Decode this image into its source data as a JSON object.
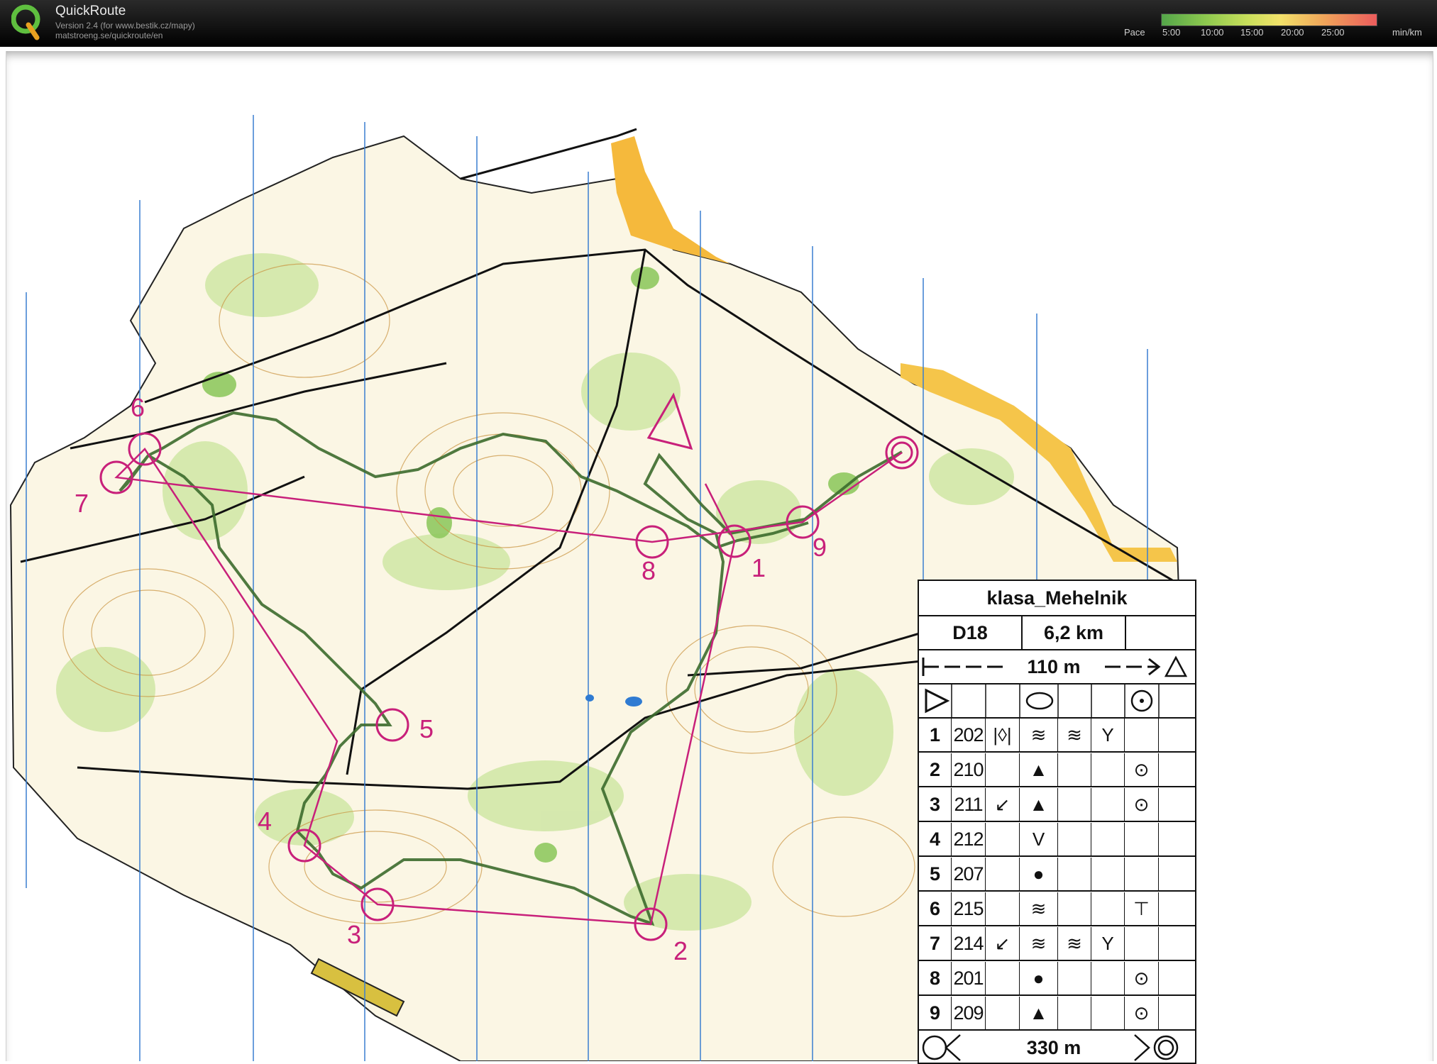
{
  "app": {
    "title": "QuickRoute",
    "version": "Version 2.4  (for www.bestik.cz/mapy)",
    "url": "matstroeng.se/quickroute/en"
  },
  "pace_legend": {
    "label": "Pace",
    "ticks": [
      "5:00",
      "10:00",
      "15:00",
      "20:00",
      "25:00"
    ],
    "unit": "min/km",
    "colors": [
      "#54a54a",
      "#8cc84e",
      "#c9df5b",
      "#f2e26a",
      "#f0a65a",
      "#ec5c5c"
    ]
  },
  "map": {
    "course_color": "#c8207a",
    "route_color": "#3a5a2a",
    "control_labels": [
      "1",
      "2",
      "3",
      "4",
      "5",
      "6",
      "7",
      "8",
      "9"
    ]
  },
  "description": {
    "event": "klasa_Mehelnik",
    "class": "D18",
    "length": "6,2 km",
    "start_distance": "110 m",
    "finish_distance": "330 m",
    "controls": [
      {
        "num": "1",
        "code": "202",
        "symbols": [
          "|◊|",
          "≋",
          "≋",
          "Y",
          ""
        ]
      },
      {
        "num": "2",
        "code": "210",
        "symbols": [
          "",
          "▲",
          "",
          "",
          "⊙"
        ]
      },
      {
        "num": "3",
        "code": "211",
        "symbols": [
          "↙",
          "▲",
          "",
          "",
          "⊙"
        ]
      },
      {
        "num": "4",
        "code": "212",
        "symbols": [
          "",
          "V",
          "",
          "",
          ""
        ]
      },
      {
        "num": "5",
        "code": "207",
        "symbols": [
          "",
          "●",
          "",
          "",
          ""
        ]
      },
      {
        "num": "6",
        "code": "215",
        "symbols": [
          "",
          "≋",
          "",
          "",
          "⊤"
        ]
      },
      {
        "num": "7",
        "code": "214",
        "symbols": [
          "↙",
          "≋",
          "≋",
          "Y",
          ""
        ]
      },
      {
        "num": "8",
        "code": "201",
        "symbols": [
          "",
          "●",
          "",
          "",
          "⊙"
        ]
      },
      {
        "num": "9",
        "code": "209",
        "symbols": [
          "",
          "▲",
          "",
          "",
          "⊙"
        ]
      }
    ]
  }
}
